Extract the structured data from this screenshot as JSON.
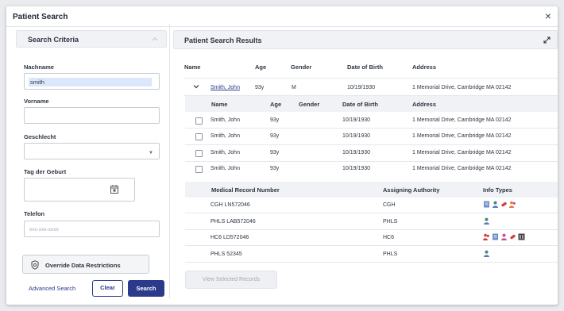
{
  "dialog": {
    "title": "Patient Search",
    "close_glyph": "×"
  },
  "criteria": {
    "title": "Search Criteria",
    "fields": {
      "nachname": {
        "label": "Nachname",
        "value": "smith"
      },
      "vorname": {
        "label": "Vorname",
        "value": ""
      },
      "geschlecht": {
        "label": "Geschlecht",
        "value": ""
      },
      "tag_der_geburt": {
        "label": "Tag der Geburt",
        "value": ""
      },
      "telefon": {
        "label": "Telefon",
        "placeholder": "xxx-xxx-xxxx"
      }
    },
    "override_label": "Override Data Restrictions",
    "advanced_label": "Advanced Search",
    "clear_label": "Clear",
    "search_label": "Search"
  },
  "results": {
    "title": "Patient Search Results",
    "columns": [
      "Name",
      "Age",
      "Gender",
      "Date of Birth",
      "Address"
    ],
    "group": {
      "name": "Smith, John",
      "age": "93y",
      "gender": "M",
      "dob": "10/19/1930",
      "address": "1 Memorial Drive, Cambridge MA 02142"
    },
    "sub_columns": [
      "Name",
      "Age",
      "Gender",
      "Date of Birth",
      "Address"
    ],
    "sub_rows": [
      {
        "name": "Smith, John",
        "age": "93y",
        "dob": "10/19/1930",
        "address": "1 Memorial Drive, Cambridge MA 02142"
      },
      {
        "name": "Smith, John",
        "age": "93y",
        "dob": "10/19/1930",
        "address": "1 Memorial Drive, Cambridge MA 02142"
      },
      {
        "name": "Smith, John",
        "age": "93y",
        "dob": "10/19/1930",
        "address": "1 Memorial Drive, Cambridge MA 02142"
      },
      {
        "name": "Smith, John",
        "age": "93y",
        "dob": "10/19/1930",
        "address": "1 Memorial Drive, Cambridge MA 02142"
      }
    ],
    "mrn_columns": [
      "Medical Record Number",
      "Assigning Authority",
      "Info Types"
    ],
    "mrn_rows": [
      {
        "mrn": "CGH LN572046",
        "authority": "CGH",
        "icons": [
          "document-icon",
          "person-icon",
          "pill-icon",
          "group-icon"
        ]
      },
      {
        "mrn": "PHLS LAB572046",
        "authority": "PHLS",
        "icons": [
          "person-icon"
        ]
      },
      {
        "mrn": "HC6 LD572046",
        "authority": "HC6",
        "icons": [
          "group-icon",
          "document-icon",
          "person-icon",
          "pill-icon",
          "image-icon"
        ]
      },
      {
        "mrn": "PHLS 52345",
        "authority": "PHLS",
        "icons": [
          "person-icon"
        ]
      }
    ],
    "view_selected_label": "View Selected Records"
  },
  "colors": {
    "accent": "#2c3a8c",
    "panel_bg": "#f1f2f5",
    "link": "#2c3a8c"
  }
}
